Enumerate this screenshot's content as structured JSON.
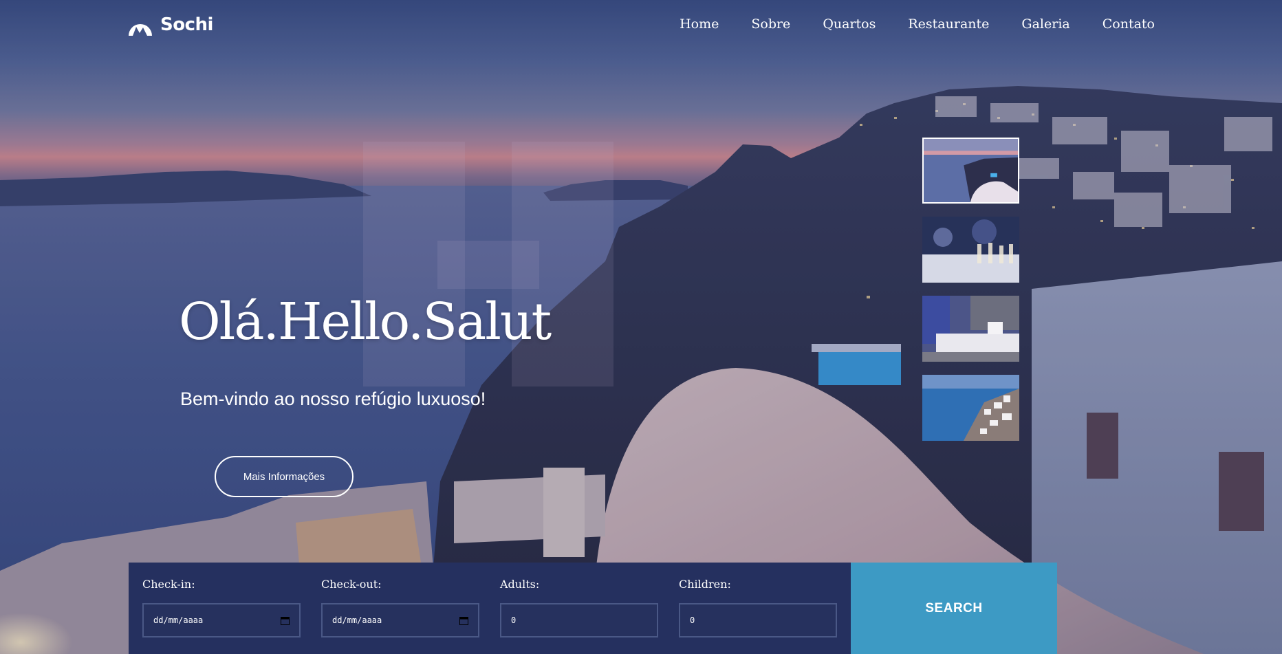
{
  "brand": {
    "name": "Sochi",
    "logo_icon": "mountain-circle-icon"
  },
  "nav": {
    "items": [
      {
        "label": "Home"
      },
      {
        "label": "Sobre"
      },
      {
        "label": "Quartos"
      },
      {
        "label": "Restaurante"
      },
      {
        "label": "Galeria"
      },
      {
        "label": "Contato"
      }
    ]
  },
  "hero": {
    "title": "Olá.Hello.Salut",
    "subtitle": "Bem-vindo ao nosso refúgio luxuoso!",
    "button_label": "Mais Informações"
  },
  "gallery": {
    "thumbnails": [
      {
        "subject": "sunset-coast-thumbnail",
        "active": true
      },
      {
        "subject": "restaurant-glasses-thumbnail",
        "active": false
      },
      {
        "subject": "hotel-room-thumbnail",
        "active": false
      },
      {
        "subject": "cliff-village-thumbnail",
        "active": false
      }
    ]
  },
  "booking": {
    "checkin": {
      "label": "Check-in:",
      "placeholder": "dd/mm/aaaa"
    },
    "checkout": {
      "label": "Check-out:",
      "placeholder": "dd/mm/aaaa"
    },
    "adults": {
      "label": "Adults:",
      "value": "0"
    },
    "children": {
      "label": "Children:",
      "value": "0"
    },
    "search_label": "SEARCH"
  },
  "colors": {
    "booking_bar": "#25305f",
    "search_button": "#3d9ac4",
    "text": "#ffffff"
  }
}
